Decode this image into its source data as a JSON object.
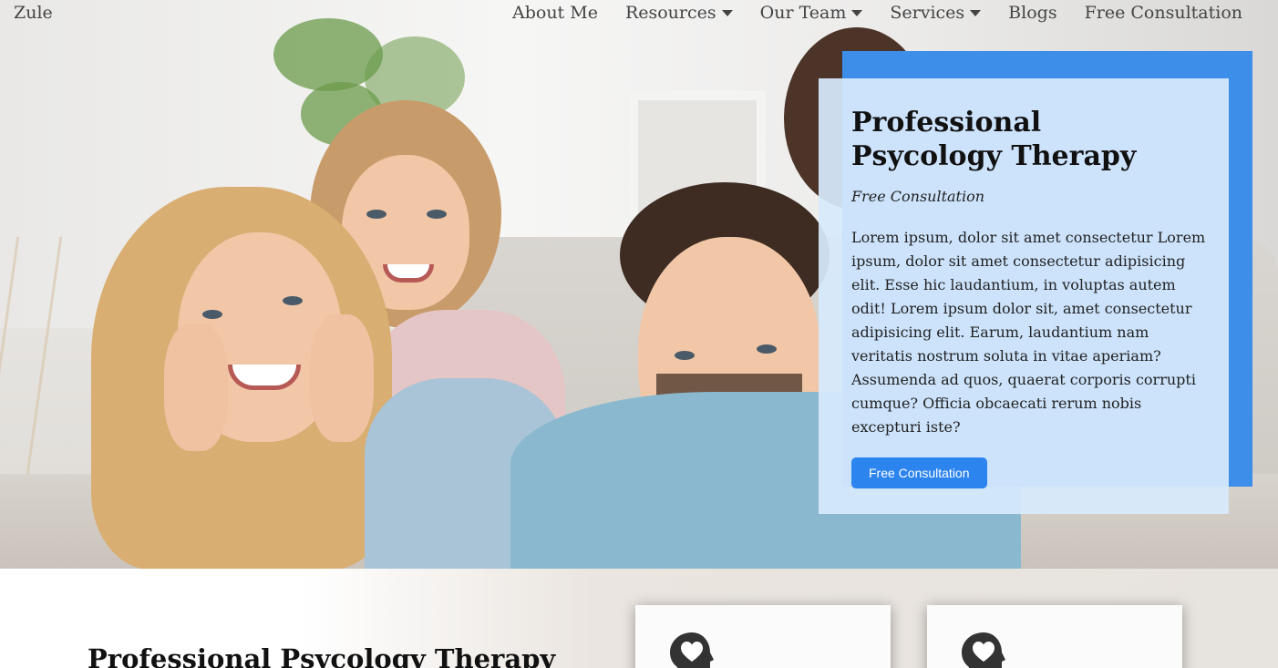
{
  "nav": {
    "brand": "Zule",
    "items": [
      {
        "label": "About Me",
        "dropdown": false
      },
      {
        "label": "Resources",
        "dropdown": true
      },
      {
        "label": "Our Team",
        "dropdown": true
      },
      {
        "label": "Services",
        "dropdown": true
      },
      {
        "label": "Blogs",
        "dropdown": false
      },
      {
        "label": "Free Consultation",
        "dropdown": false
      }
    ]
  },
  "hero": {
    "title": "Professional Psycology Therapy",
    "subtitle": "Free Consultation",
    "body": "Lorem ipsum, dolor sit amet consectetur Lorem ipsum, dolor sit amet consectetur adipisicing elit. Esse hic laudantium, in voluptas autem odit! Lorem ipsum dolor sit, amet consectetur adipisicing elit. Earum, laudantium nam veritatis nostrum soluta in vitae aperiam? Assumenda ad quos, quaerat corporis corrupti cumque? Officia obcaecati rerum nobis excepturi iste?",
    "button_label": "Free Consultation"
  },
  "section": {
    "title": "Professional Psycology Therapy"
  },
  "colors": {
    "accent": "#3c8ee8",
    "button": "#2c84ee",
    "card_bg": "#d7e9fc"
  },
  "icons": {
    "service": "head-heart-icon"
  }
}
